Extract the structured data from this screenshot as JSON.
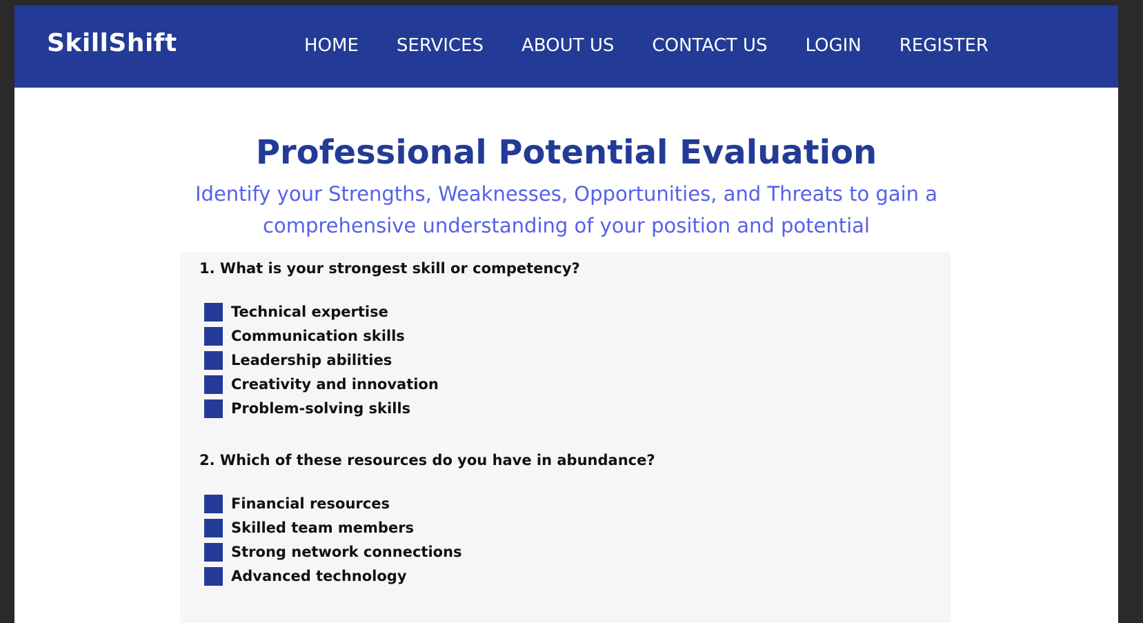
{
  "brand": "SkillShift",
  "nav": {
    "home": "HOME",
    "services": "SERVICES",
    "about": "ABOUT US",
    "contact": "CONTACT US",
    "login": "LOGIN",
    "register": "REGISTER"
  },
  "page": {
    "title": "Professional Potential Evaluation",
    "subtitle": "Identify your Strengths, Weaknesses, Opportunities, and Threats to gain a comprehensive understanding of your position and potential"
  },
  "questions": [
    {
      "text": "1. What is your strongest skill or competency?",
      "options": [
        "Technical expertise",
        "Communication skills",
        "Leadership abilities",
        "Creativity and innovation",
        "Problem-solving skills"
      ]
    },
    {
      "text": "2. Which of these resources do you have in abundance?",
      "options": [
        "Financial resources",
        "Skilled team members",
        "Strong network connections",
        "Advanced technology"
      ]
    }
  ],
  "colors": {
    "primary": "#233b96",
    "accent": "#5561e8",
    "panel": "#f6f6f6"
  }
}
